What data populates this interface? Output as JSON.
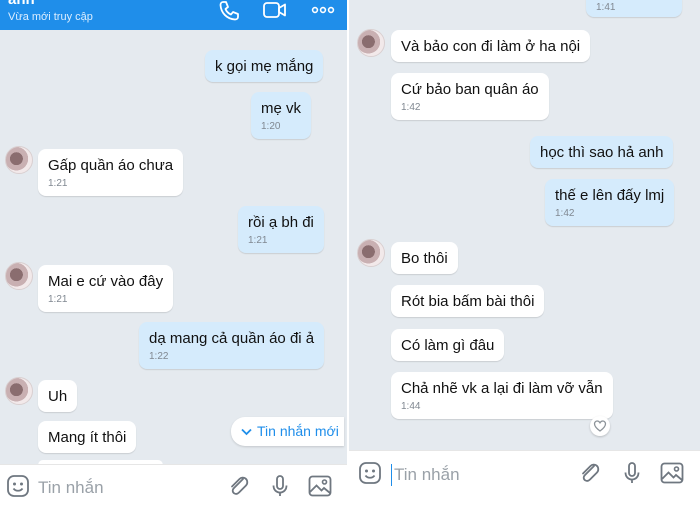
{
  "left": {
    "header": {
      "name": "anh",
      "status": "Vừa mới truy cập",
      "icons": [
        "phone-icon",
        "video-call-icon",
        "more-options-icon"
      ]
    },
    "messages": [
      {
        "from": "me",
        "text": "k gọi mẹ mắng",
        "time": ""
      },
      {
        "from": "me",
        "text": "mẹ vk",
        "time": "1:20"
      },
      {
        "from": "them",
        "text": "Gấp quần áo chưa",
        "time": "1:21"
      },
      {
        "from": "me",
        "text": "rồi ạ bh đi",
        "time": "1:21"
      },
      {
        "from": "them",
        "text": "Mai e cứ vào đây",
        "time": "1:21"
      },
      {
        "from": "me",
        "text": "dạ mang cả quần áo đi ả",
        "time": "1:22"
      },
      {
        "from": "them",
        "text": "Uh",
        "time": ""
      },
      {
        "from": "them",
        "text": "Mang ít thôi",
        "time": ""
      }
    ],
    "new_messages_label": "Tin nhắn mới",
    "input_placeholder": "Tin nhắn"
  },
  "right": {
    "messages": [
      {
        "from": "me",
        "text": "",
        "time": "1:41"
      },
      {
        "from": "them",
        "text": "Và bảo con đi làm ở ha nội",
        "time": ""
      },
      {
        "from": "them",
        "text": "Cứ bảo ban quân áo",
        "time": "1:42"
      },
      {
        "from": "me",
        "text": "học thì sao hả anh",
        "time": ""
      },
      {
        "from": "me",
        "text": "thế e lên đấy lmj",
        "time": "1:42"
      },
      {
        "from": "them",
        "text": "Bo thôi",
        "time": ""
      },
      {
        "from": "them",
        "text": "Rót bia bấm bài thôi",
        "time": ""
      },
      {
        "from": "them",
        "text": "Có làm gì đâu",
        "time": ""
      },
      {
        "from": "them",
        "text": "Chả nhẽ vk a lại đi làm vỡ vẫn",
        "time": "1:44"
      }
    ],
    "input_placeholder": "Tin nhắn"
  },
  "colors": {
    "accent": "#1f8eea",
    "chat_background": "#e5eaef",
    "own_bubble": "#d5ebfc",
    "other_bubble": "#ffffff"
  }
}
